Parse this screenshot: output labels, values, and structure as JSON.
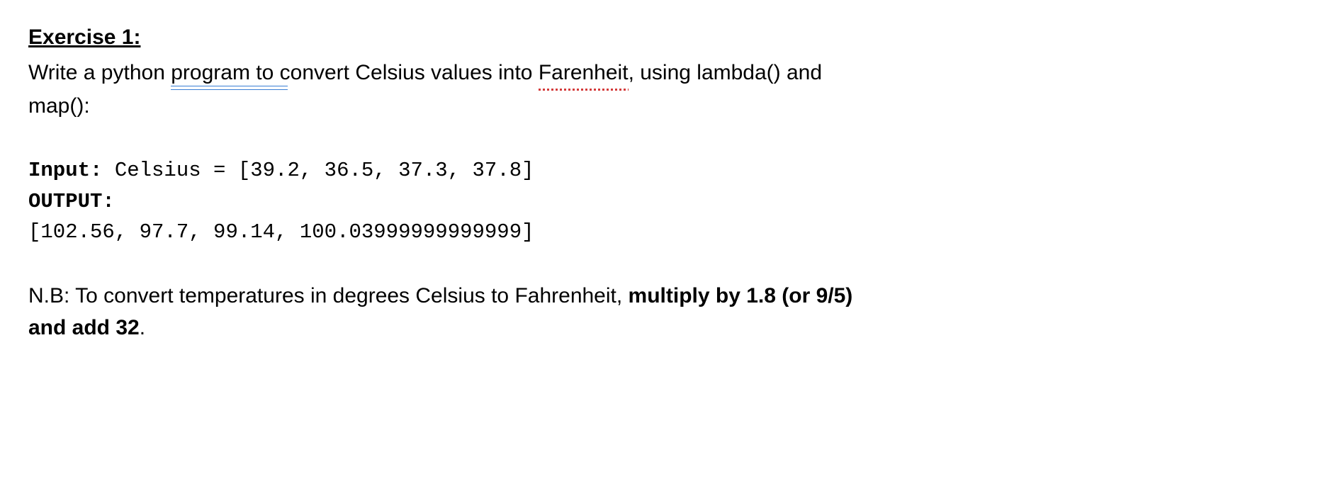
{
  "exercise": {
    "title": "Exercise 1:",
    "instruction_pre": "Write a python ",
    "program_word": "program  to",
    "instruction_mid": " convert Celsius values into ",
    "farenheit_word": "Farenheit",
    "instruction_post": ", using lambda() and",
    "instruction_line2": "map():"
  },
  "code": {
    "input_label": "Input:",
    "input_value": " Celsius = [39.2, 36.5, 37.3, 37.8]",
    "output_label": "OUTPUT:",
    "output_value": "[102.56, 97.7, 99.14, 100.03999999999999]"
  },
  "note": {
    "nb_label": "N.B",
    "nb_text": ": To convert temperatures in degrees Celsius to Fahrenheit, ",
    "nb_bold1": "multiply by 1.8 (or 9/5)",
    "nb_bold2": "and add 32",
    "nb_end": "."
  }
}
